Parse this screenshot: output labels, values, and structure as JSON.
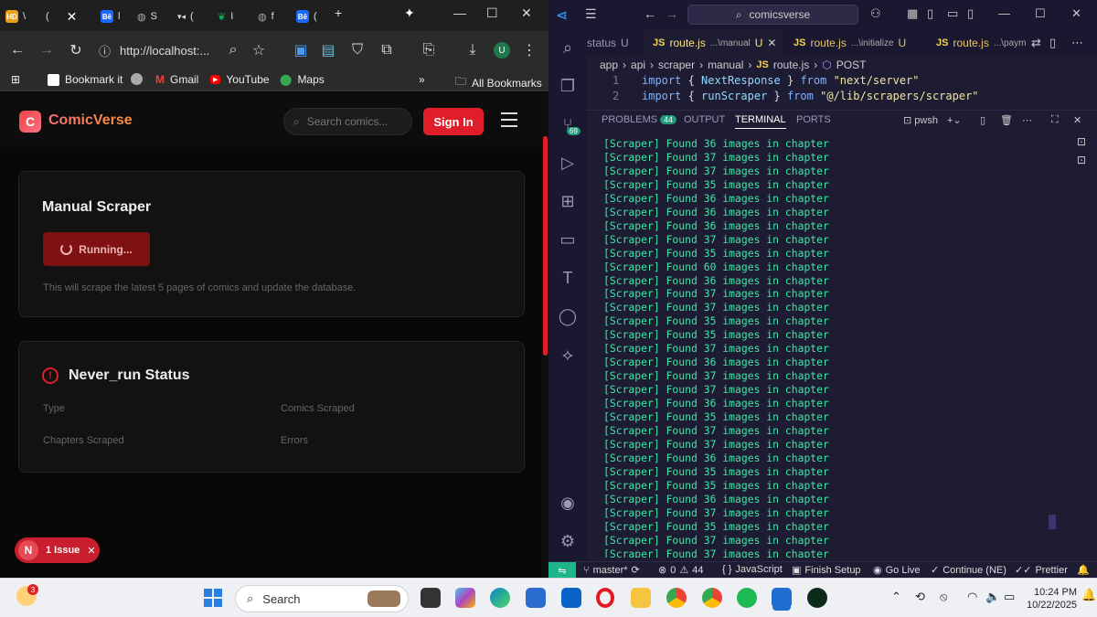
{
  "browser": {
    "tabs": [
      {
        "favicon_text": "HD",
        "label": "\\",
        "color": "#e8a11a"
      },
      {
        "favicon_text": "",
        "label": "(",
        "color": ""
      },
      {
        "favicon_text": "Bē",
        "label": "l",
        "color": "#1769ff"
      },
      {
        "favicon_text": "",
        "label": "S",
        "color": ""
      },
      {
        "favicon_text": "",
        "label": "(",
        "color": ""
      },
      {
        "favicon_text": "",
        "label": "I",
        "color": "#10aa50"
      },
      {
        "favicon_text": "",
        "label": "f",
        "color": ""
      },
      {
        "favicon_text": "Bē",
        "label": "(",
        "color": "#1769ff"
      }
    ],
    "new_tab": "+",
    "url": "http://localhost:...",
    "bookmarks": [
      "Bookmark it",
      "Gmail",
      "YouTube",
      "Maps"
    ],
    "all_bookmarks": "All Bookmarks",
    "more": "»"
  },
  "site": {
    "logo_letter": "C",
    "brand": "ComicVerse",
    "search_placeholder": "Search comics...",
    "signin": "Sign In",
    "manual": {
      "title": "Manual Scraper",
      "button": "Running...",
      "description": "This will scrape the latest 5 pages of comics and update the database."
    },
    "status": {
      "title": "Never_run Status",
      "fields": [
        "Type",
        "Comics Scraped",
        "Chapters Scraped",
        "Errors"
      ]
    },
    "issue_letter": "N",
    "issue_label": "1 Issue",
    "issue_close": "✕"
  },
  "vscode": {
    "command_center": "comicsverse",
    "tabs": [
      {
        "lang": "",
        "name": "status",
        "path": "",
        "status": "U"
      },
      {
        "lang": "JS",
        "name": "route.js",
        "path": "...\\manual",
        "status": "U"
      },
      {
        "lang": "JS",
        "name": "route.js",
        "path": "...\\initialize",
        "status": "U"
      },
      {
        "lang": "JS",
        "name": "route.js",
        "path": "...\\paym",
        "status": ""
      }
    ],
    "breadcrumbs": [
      "app",
      "api",
      "scraper",
      "manual",
      "route.js",
      "POST"
    ],
    "breadcrumb_lang": "JS",
    "code": [
      {
        "n": "1",
        "kw": "import",
        "lb": "{ ",
        "id": "NextResponse",
        "rb": " }",
        "from": "from",
        "str": "\"next/server\""
      },
      {
        "n": "2",
        "kw": "import",
        "lb": "{ ",
        "id": "runScraper",
        "rb": " }",
        "from": "from",
        "str": "\"@/lib/scrapers/scraper\""
      }
    ],
    "panel_tabs": [
      "PROBLEMS",
      "OUTPUT",
      "TERMINAL",
      "PORTS"
    ],
    "problems_count": "44",
    "shell": "pwsh",
    "activity_badge": "69",
    "terminal_lines": [
      "[Scraper] Found 36 images in chapter",
      "[Scraper] Found 37 images in chapter",
      "[Scraper] Found 37 images in chapter",
      "[Scraper] Found 35 images in chapter",
      "[Scraper] Found 36 images in chapter",
      "[Scraper] Found 36 images in chapter",
      "[Scraper] Found 36 images in chapter",
      "[Scraper] Found 37 images in chapter",
      "[Scraper] Found 35 images in chapter",
      "[Scraper] Found 60 images in chapter",
      "[Scraper] Found 36 images in chapter",
      "[Scraper] Found 37 images in chapter",
      "[Scraper] Found 37 images in chapter",
      "[Scraper] Found 35 images in chapter",
      "[Scraper] Found 35 images in chapter",
      "[Scraper] Found 37 images in chapter",
      "[Scraper] Found 36 images in chapter",
      "[Scraper] Found 37 images in chapter",
      "[Scraper] Found 37 images in chapter",
      "[Scraper] Found 36 images in chapter",
      "[Scraper] Found 35 images in chapter",
      "[Scraper] Found 37 images in chapter",
      "[Scraper] Found 37 images in chapter",
      "[Scraper] Found 36 images in chapter",
      "[Scraper] Found 35 images in chapter",
      "[Scraper] Found 35 images in chapter",
      "[Scraper] Found 36 images in chapter",
      "[Scraper] Found 37 images in chapter",
      "[Scraper] Found 35 images in chapter",
      "[Scraper] Found 37 images in chapter",
      "[Scraper] Found 37 images in chapter"
    ],
    "status": {
      "branch": "master*",
      "errors": "0",
      "warnings": "44",
      "language": "JavaScript",
      "setup": "Finish Setup",
      "live": "Go Live",
      "continue": "Continue (NE)",
      "prettier": "Prettier"
    }
  },
  "taskbar": {
    "weather_badge": "3",
    "search": "Search",
    "time": "10:24 PM",
    "date": "10/22/2025"
  },
  "colors": {
    "accent_red": "#e11d2a",
    "terminal_green": "#3ee6a6",
    "vscode_bg": "#1e1c33",
    "status_green": "#1fb58a"
  }
}
